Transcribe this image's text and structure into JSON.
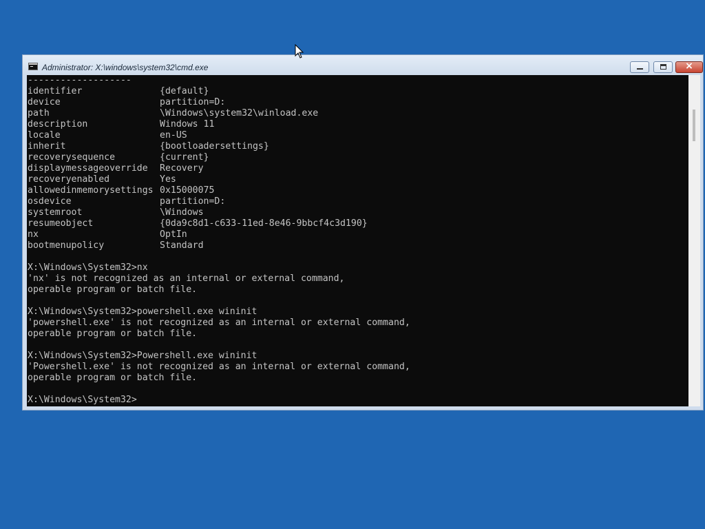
{
  "window": {
    "title": "Administrator: X:\\windows\\system32\\cmd.exe",
    "controls": {
      "minimize": "minimize",
      "maximize": "maximize",
      "close": "×"
    }
  },
  "console": {
    "separator": "-------------------",
    "properties": [
      {
        "key": "identifier",
        "value": "{default}"
      },
      {
        "key": "device",
        "value": "partition=D:"
      },
      {
        "key": "path",
        "value": "\\Windows\\system32\\winload.exe"
      },
      {
        "key": "description",
        "value": "Windows 11"
      },
      {
        "key": "locale",
        "value": "en-US"
      },
      {
        "key": "inherit",
        "value": "{bootloadersettings}"
      },
      {
        "key": "recoverysequence",
        "value": "{current}"
      },
      {
        "key": "displaymessageoverride",
        "value": "Recovery"
      },
      {
        "key": "recoveryenabled",
        "value": "Yes"
      },
      {
        "key": "allowedinmemorysettings",
        "value": "0x15000075"
      },
      {
        "key": "osdevice",
        "value": "partition=D:"
      },
      {
        "key": "systemroot",
        "value": "\\Windows"
      },
      {
        "key": "resumeobject",
        "value": "{0da9c8d1-c633-11ed-8e46-9bbcf4c3d190}"
      },
      {
        "key": "nx",
        "value": "OptIn"
      },
      {
        "key": "bootmenupolicy",
        "value": "Standard"
      }
    ],
    "output_lines": [
      "",
      "X:\\Windows\\System32>nx",
      "'nx' is not recognized as an internal or external command,",
      "operable program or batch file.",
      "",
      "X:\\Windows\\System32>powershell.exe wininit",
      "'powershell.exe' is not recognized as an internal or external command,",
      "operable program or batch file.",
      "",
      "X:\\Windows\\System32>Powershell.exe wininit",
      "'Powershell.exe' is not recognized as an internal or external command,",
      "operable program or batch file.",
      "",
      "X:\\Windows\\System32>"
    ]
  },
  "colors": {
    "desktop": "#1f66b3",
    "console_bg": "#0c0c0c",
    "console_text": "#c4c4c4"
  },
  "icons": {
    "window_icon": "cmd-icon",
    "pointer": "mouse-pointer-icon"
  }
}
